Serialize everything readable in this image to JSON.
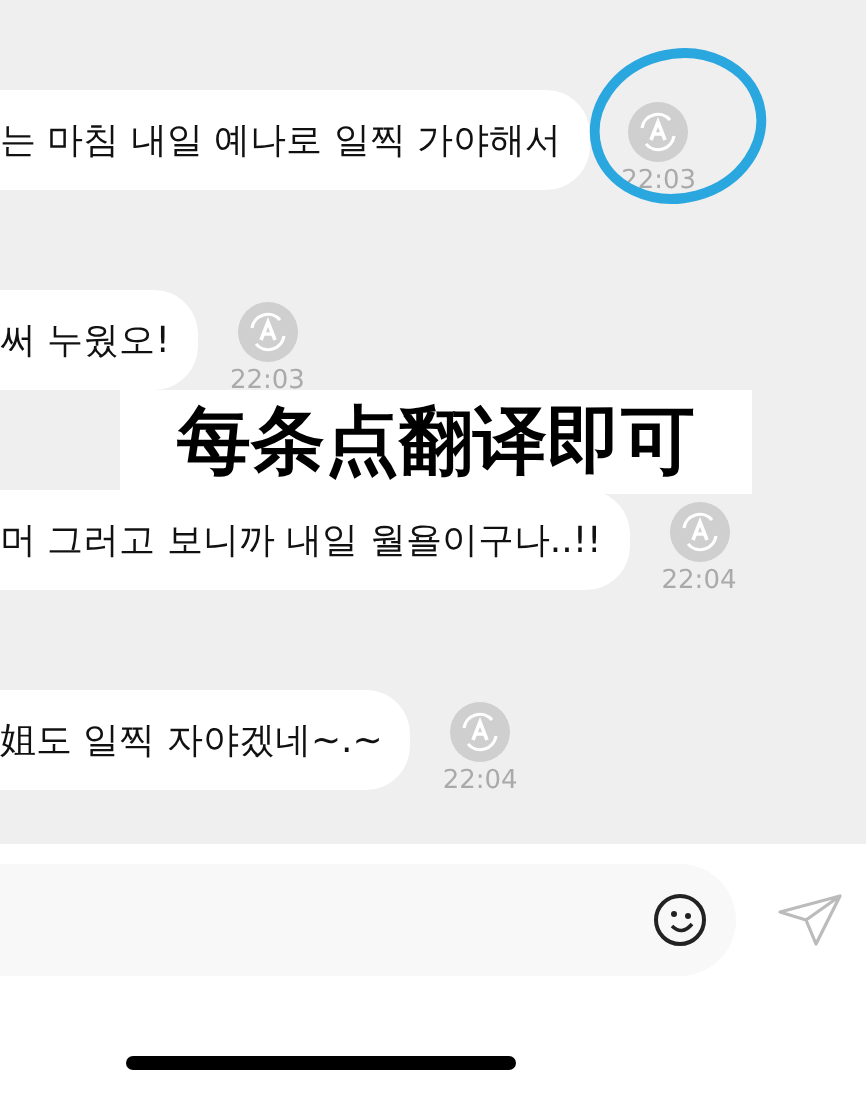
{
  "messages": [
    {
      "text": "는 마침 내일 예나로 일찍 가야해서",
      "time": "22:03",
      "circled": true
    },
    {
      "text": "써 누웠오!",
      "time": "22:03",
      "circled": false
    },
    {
      "text": "머 그러고 보니까 내일 월욜이구나..!!",
      "time": "22:04",
      "circled": false
    },
    {
      "text": "姐도 일찍 자야겠네~.~",
      "time": "22:04",
      "circled": false
    }
  ],
  "caption": "每条点翻译即可"
}
